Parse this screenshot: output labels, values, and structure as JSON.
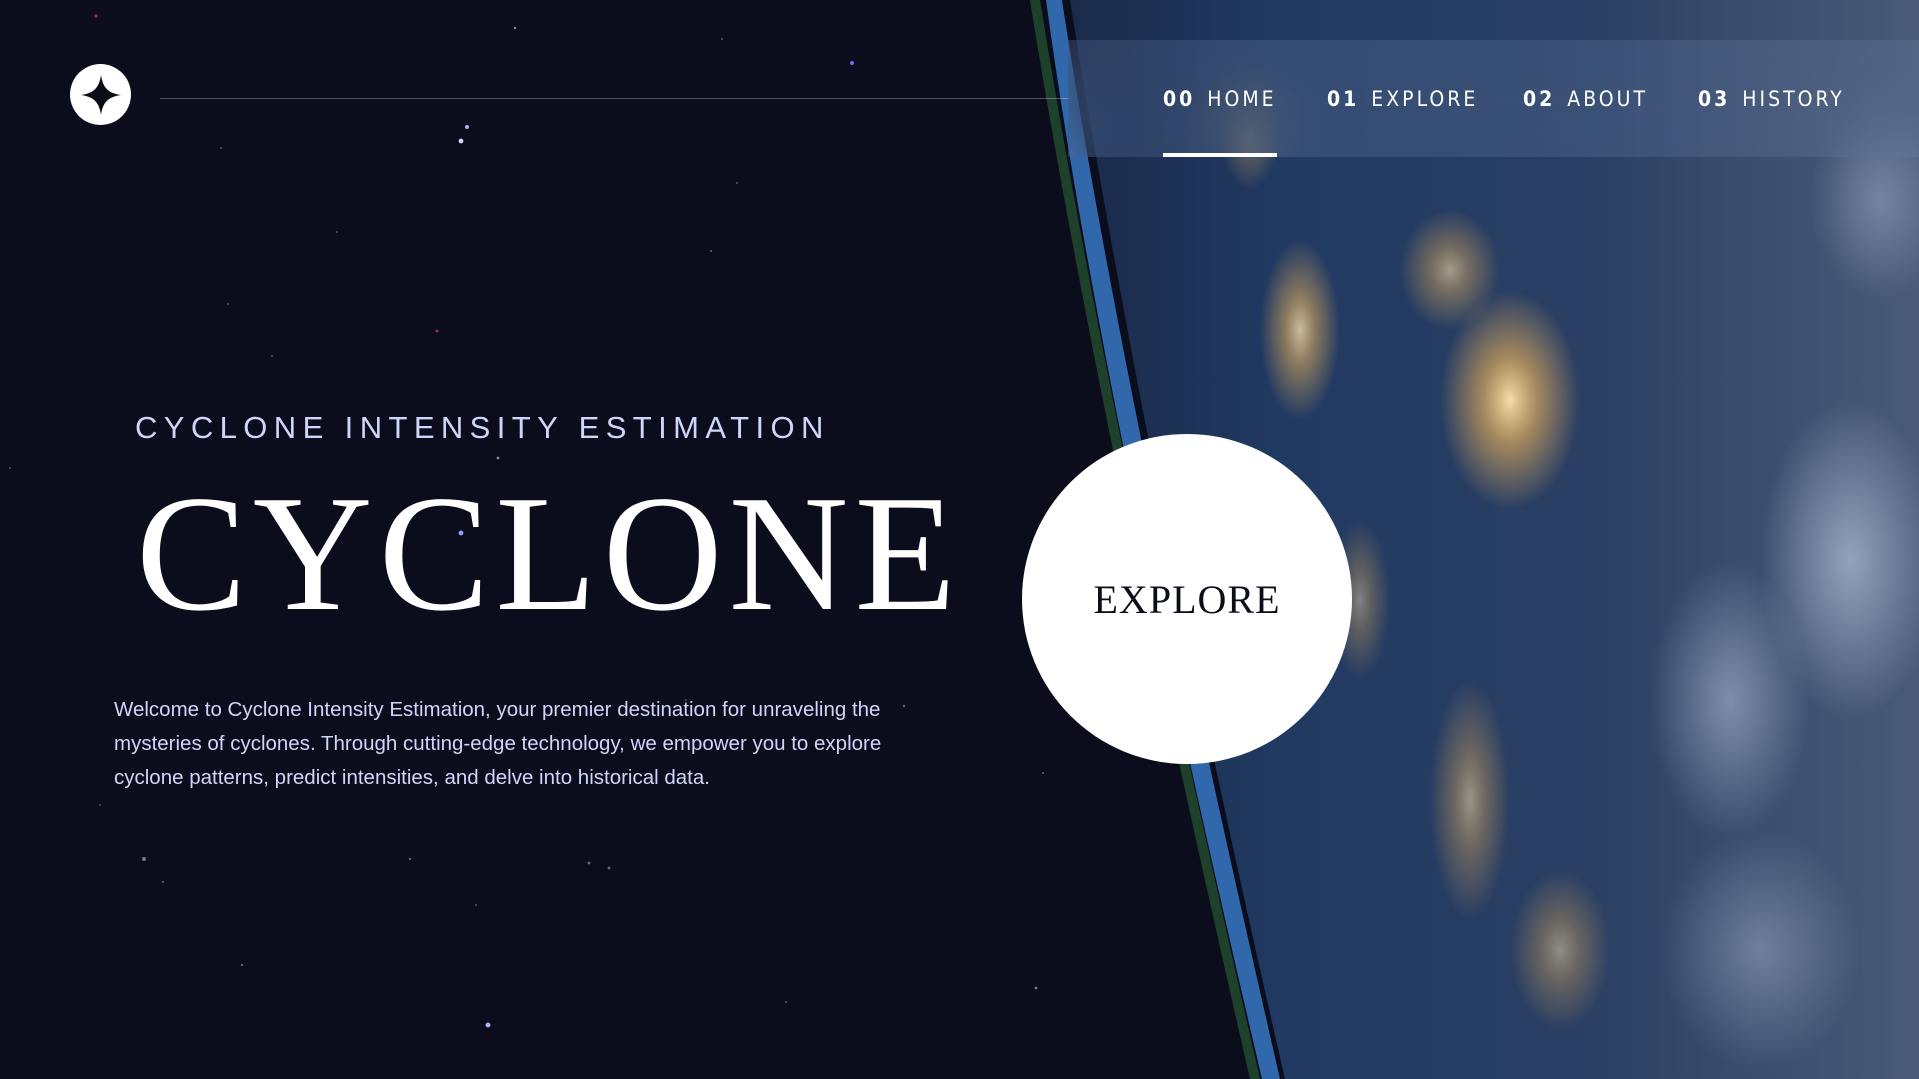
{
  "brand": {
    "logo_icon": "four-point-star-icon"
  },
  "nav": {
    "items": [
      {
        "number": "00",
        "label": "HOME",
        "active": true
      },
      {
        "number": "01",
        "label": "EXPLORE",
        "active": false
      },
      {
        "number": "02",
        "label": "ABOUT",
        "active": false
      },
      {
        "number": "03",
        "label": "HISTORY",
        "active": false
      }
    ]
  },
  "hero": {
    "eyebrow": "CYCLONE INTENSITY ESTIMATION",
    "title": "CYCLONE",
    "description": "Welcome to Cyclone Intensity Estimation, your premier destination for unraveling the mysteries of cyclones. Through cutting-edge technology, we empower you to explore cyclone patterns, predict intensities, and delve into historical data.",
    "cta_label": "EXPLORE"
  },
  "colors": {
    "background": "#0b0d1c",
    "accent_text": "#d0d6f9",
    "white": "#ffffff"
  }
}
